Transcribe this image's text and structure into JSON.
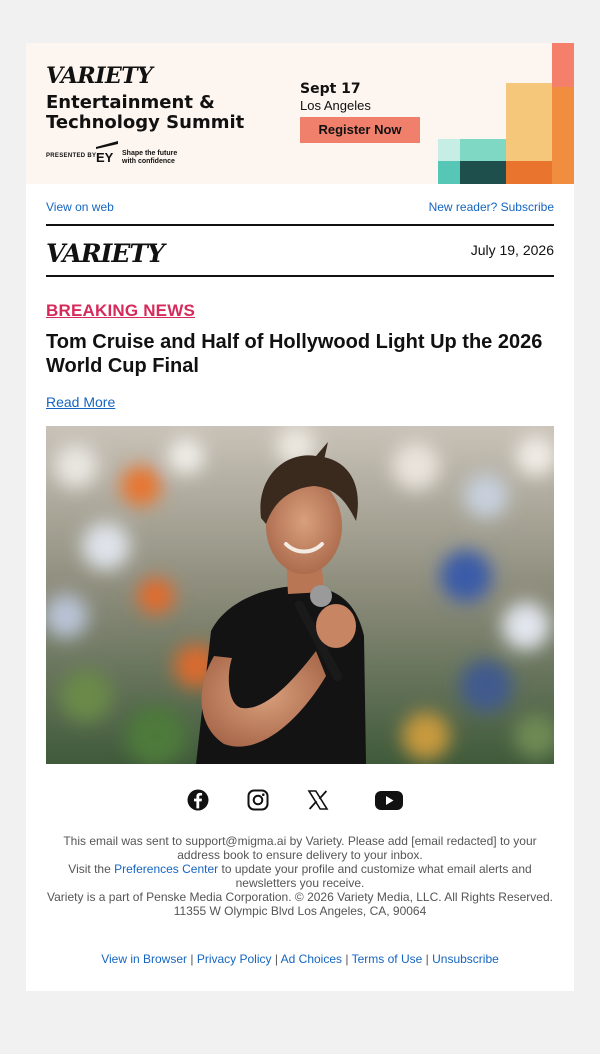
{
  "banner": {
    "brand": "VARIETY",
    "summit_line1": "Entertainment &",
    "summit_line2": "Technology Summit",
    "presented_by": "PRESENTED BY",
    "sponsor": "EY",
    "sponsor_tag": "Shape the future with confidence",
    "date": "Sept 17",
    "city": "Los Angeles",
    "register_label": "Register Now",
    "colors": {
      "background": "#fdf5ef",
      "button": "#f0806b"
    }
  },
  "header": {
    "view_on_web": "View on web",
    "subscribe": "New reader? Subscribe",
    "brand": "VARIETY",
    "date": "July 19, 2026"
  },
  "article": {
    "kicker": "BREAKING NEWS",
    "headline": "Tom Cruise and Half of Hollywood Light Up the 2026 World Cup Final",
    "read_more": "Read More",
    "image_alt": "Tom Cruise smiling holding a microphone in a stadium",
    "kicker_color": "#d62a5a",
    "link_color": "#1565c0"
  },
  "social": [
    {
      "name": "facebook-icon"
    },
    {
      "name": "instagram-icon"
    },
    {
      "name": "x-icon"
    },
    {
      "name": "youtube-icon"
    }
  ],
  "footer": {
    "sent_prefix": "This email was sent to support@migma.ai by Variety. Please add [email redacted] to your address book to ensure delivery to your inbox.",
    "visit_prefix": "Visit the ",
    "preferences_link": "Preferences Center",
    "visit_suffix": " to update your profile and customize what email alerts and newsletters you receive.",
    "copyright": "Variety is a part of Penske Media Corporation. © 2026 Variety Media, LLC. All Rights Reserved.",
    "address": "11355 W Olympic Blvd Los Angeles, CA, 90064",
    "links": [
      "View in Browser",
      "Privacy Policy",
      "Ad Choices",
      "Terms of Use",
      "Unsubscribe"
    ],
    "separator": "|"
  }
}
